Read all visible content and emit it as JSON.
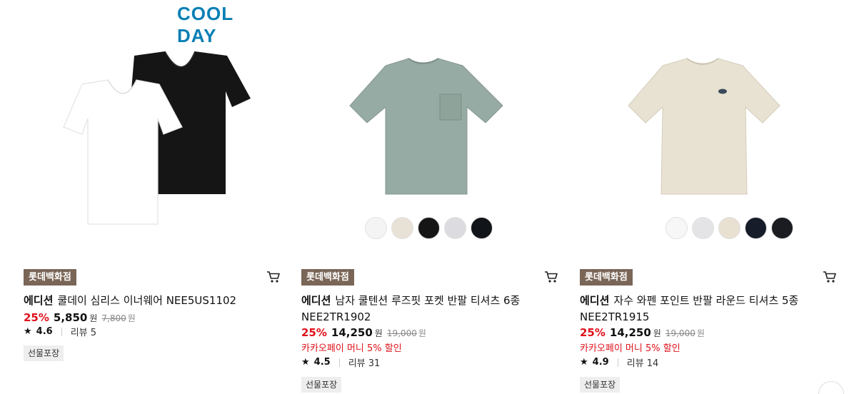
{
  "products": [
    {
      "banner": "COOL DAY",
      "store": "롯데백화점",
      "brand": "에디션",
      "name": "쿨데이 심리스 이너웨어 NEE5US1102",
      "discount": "25%",
      "price": "5,850",
      "won": "원",
      "original_price": "7,800",
      "original_won": "원",
      "rating": "4.6",
      "review": "리뷰 5",
      "tag": "선물포장",
      "swatches": []
    },
    {
      "store": "롯데백화점",
      "brand": "에디션",
      "name": "남자 쿨텐션 루즈핏 포켓 반팔 티셔츠 6종 NEE2TR1902",
      "discount": "25%",
      "price": "14,250",
      "won": "원",
      "original_price": "19,000",
      "original_won": "원",
      "promo": "카카오페이 머니 5% 할인",
      "rating": "4.5",
      "review": "리뷰 31",
      "tag": "선물포장",
      "swatches": [
        "#f4f4f4",
        "#e8e2d6",
        "#151515",
        "#dcdce0",
        "#111418"
      ]
    },
    {
      "store": "롯데백화점",
      "brand": "에디션",
      "name": "자수 와펜 포인트 반팔 라운드 티셔츠 5종 NEE2TR1915",
      "discount": "25%",
      "price": "14,250",
      "won": "원",
      "original_price": "19,000",
      "original_won": "원",
      "promo": "카카오페이 머니 5% 할인",
      "rating": "4.9",
      "review": "리뷰 14",
      "tag": "선물포장",
      "swatches": [
        "#f7f7f7",
        "#e4e4e6",
        "#e8e0d0",
        "#161c2a",
        "#1a1c22"
      ]
    }
  ],
  "colors": {
    "accent_red": "#e0101a",
    "store_badge": "#7a6657",
    "banner_blue": "#0a7fb5"
  }
}
